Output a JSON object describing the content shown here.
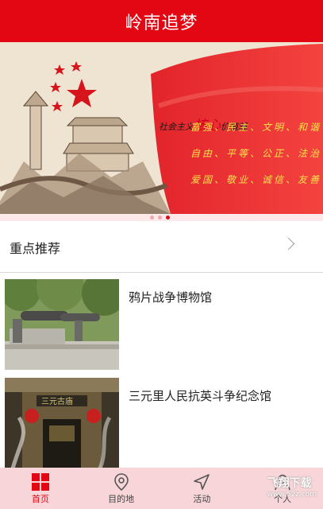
{
  "header": {
    "title": "岭南追梦"
  },
  "banner": {
    "slogan_prefix": "社会主义",
    "slogan_emphasis": "核心",
    "slogan_suffix": "价值观",
    "lines": [
      "富强、民主、文明、和谐",
      "自由、平等、公正、法治",
      "爱国、敬业、诚信、友善"
    ],
    "pager_index": 2,
    "pager_count": 3
  },
  "section": {
    "title": "重点推荐"
  },
  "items": [
    {
      "title": "鸦片战争博物馆"
    },
    {
      "title": "三元里人民抗英斗争纪念馆"
    }
  ],
  "tabs": [
    {
      "label": "首页",
      "icon": "home-grid-icon",
      "active": true
    },
    {
      "label": "目的地",
      "icon": "location-pin-icon",
      "active": false
    },
    {
      "label": "活动",
      "icon": "navigation-arrow-icon",
      "active": false
    },
    {
      "label": "个人",
      "icon": "person-icon",
      "active": false
    }
  ],
  "watermark": {
    "text": "飞翔下载",
    "sub": "www.52z.com"
  },
  "colors": {
    "brand_red": "#e30613",
    "tabbar_bg": "#f7d5d8"
  }
}
